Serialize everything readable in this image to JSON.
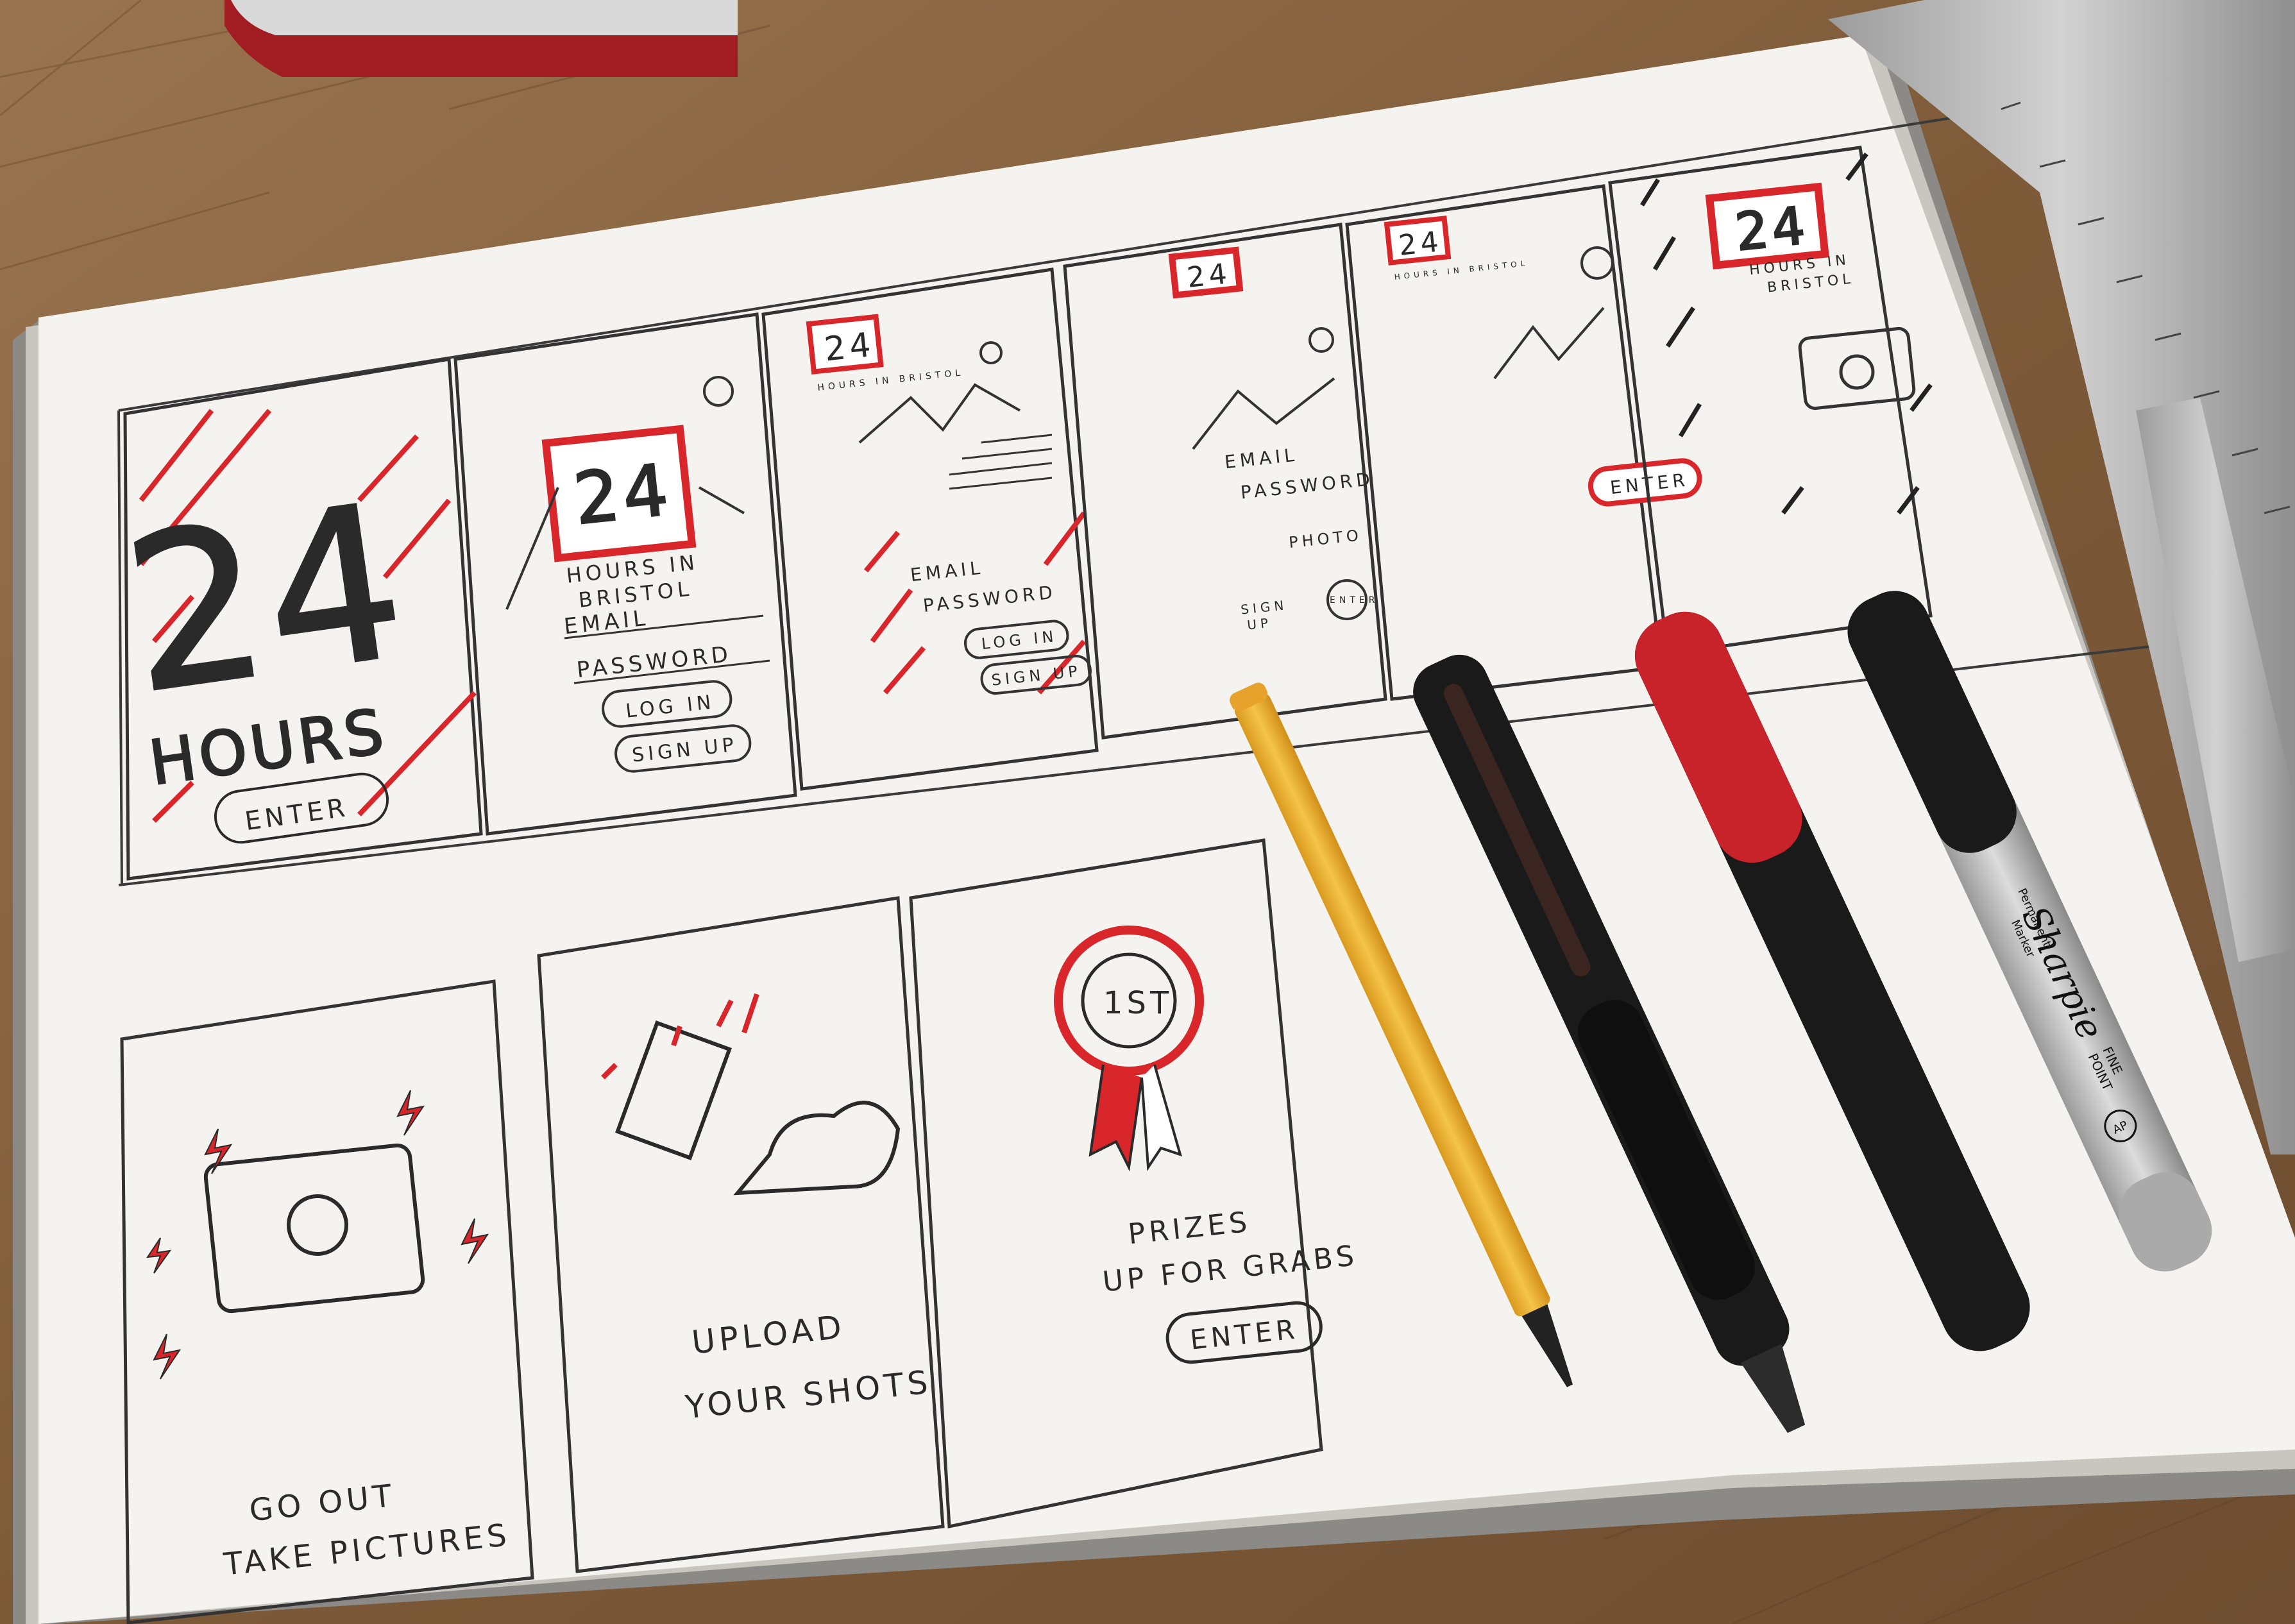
{
  "colors": {
    "wood": "#8a6440",
    "paper": "#f4f3ef",
    "ink": "#2a2a2a",
    "red": "#d8262b",
    "pencil": "#f2b73a",
    "ruler": "#b9b9b9"
  },
  "top_row": {
    "s1": {
      "number": "24",
      "hours": "HOURS",
      "enter": "ENTER"
    },
    "s2": {
      "logo_num": "24",
      "logo_sub1": "HOURS IN",
      "logo_sub2": "BRISTOL",
      "email": "EMAIL",
      "password": "PASSWORD",
      "login": "LOG IN",
      "signup": "SIGN UP"
    },
    "s3": {
      "logo_num": "24",
      "logo_sub": "HOURS IN BRISTOL",
      "email": "EMAIL",
      "password": "PASSWORD",
      "login": "LOG IN",
      "signup": "SIGN UP"
    },
    "s4": {
      "logo_num": "24",
      "email": "EMAIL",
      "password": "PASSWORD",
      "photo": "PHOTO",
      "signup1": "SIGN",
      "signup2": "UP",
      "enter": "ENTER"
    },
    "s5": {
      "logo_num": "24",
      "logo_sub": "HOURS IN BRISTOL",
      "enter": "ENTER"
    },
    "s6": {
      "logo_num": "24",
      "logo_sub1": "HOURS IN",
      "logo_sub2": "BRISTOL"
    }
  },
  "bottom_row": {
    "b1": {
      "line1": "GO OUT",
      "line2": "TAKE PICTURES"
    },
    "b2": {
      "line1": "UPLOAD",
      "line2": "YOUR SHOTS"
    },
    "b3": {
      "badge": "1ST",
      "line1": "PRIZES",
      "line2": "UP FOR GRABS",
      "enter": "ENTER"
    }
  },
  "sharpie": {
    "brand": "Sharpie",
    "sub1": "Permanent",
    "sub2": "Marker",
    "tip1": "FINE",
    "tip2": "POINT",
    "seal": "AP"
  }
}
